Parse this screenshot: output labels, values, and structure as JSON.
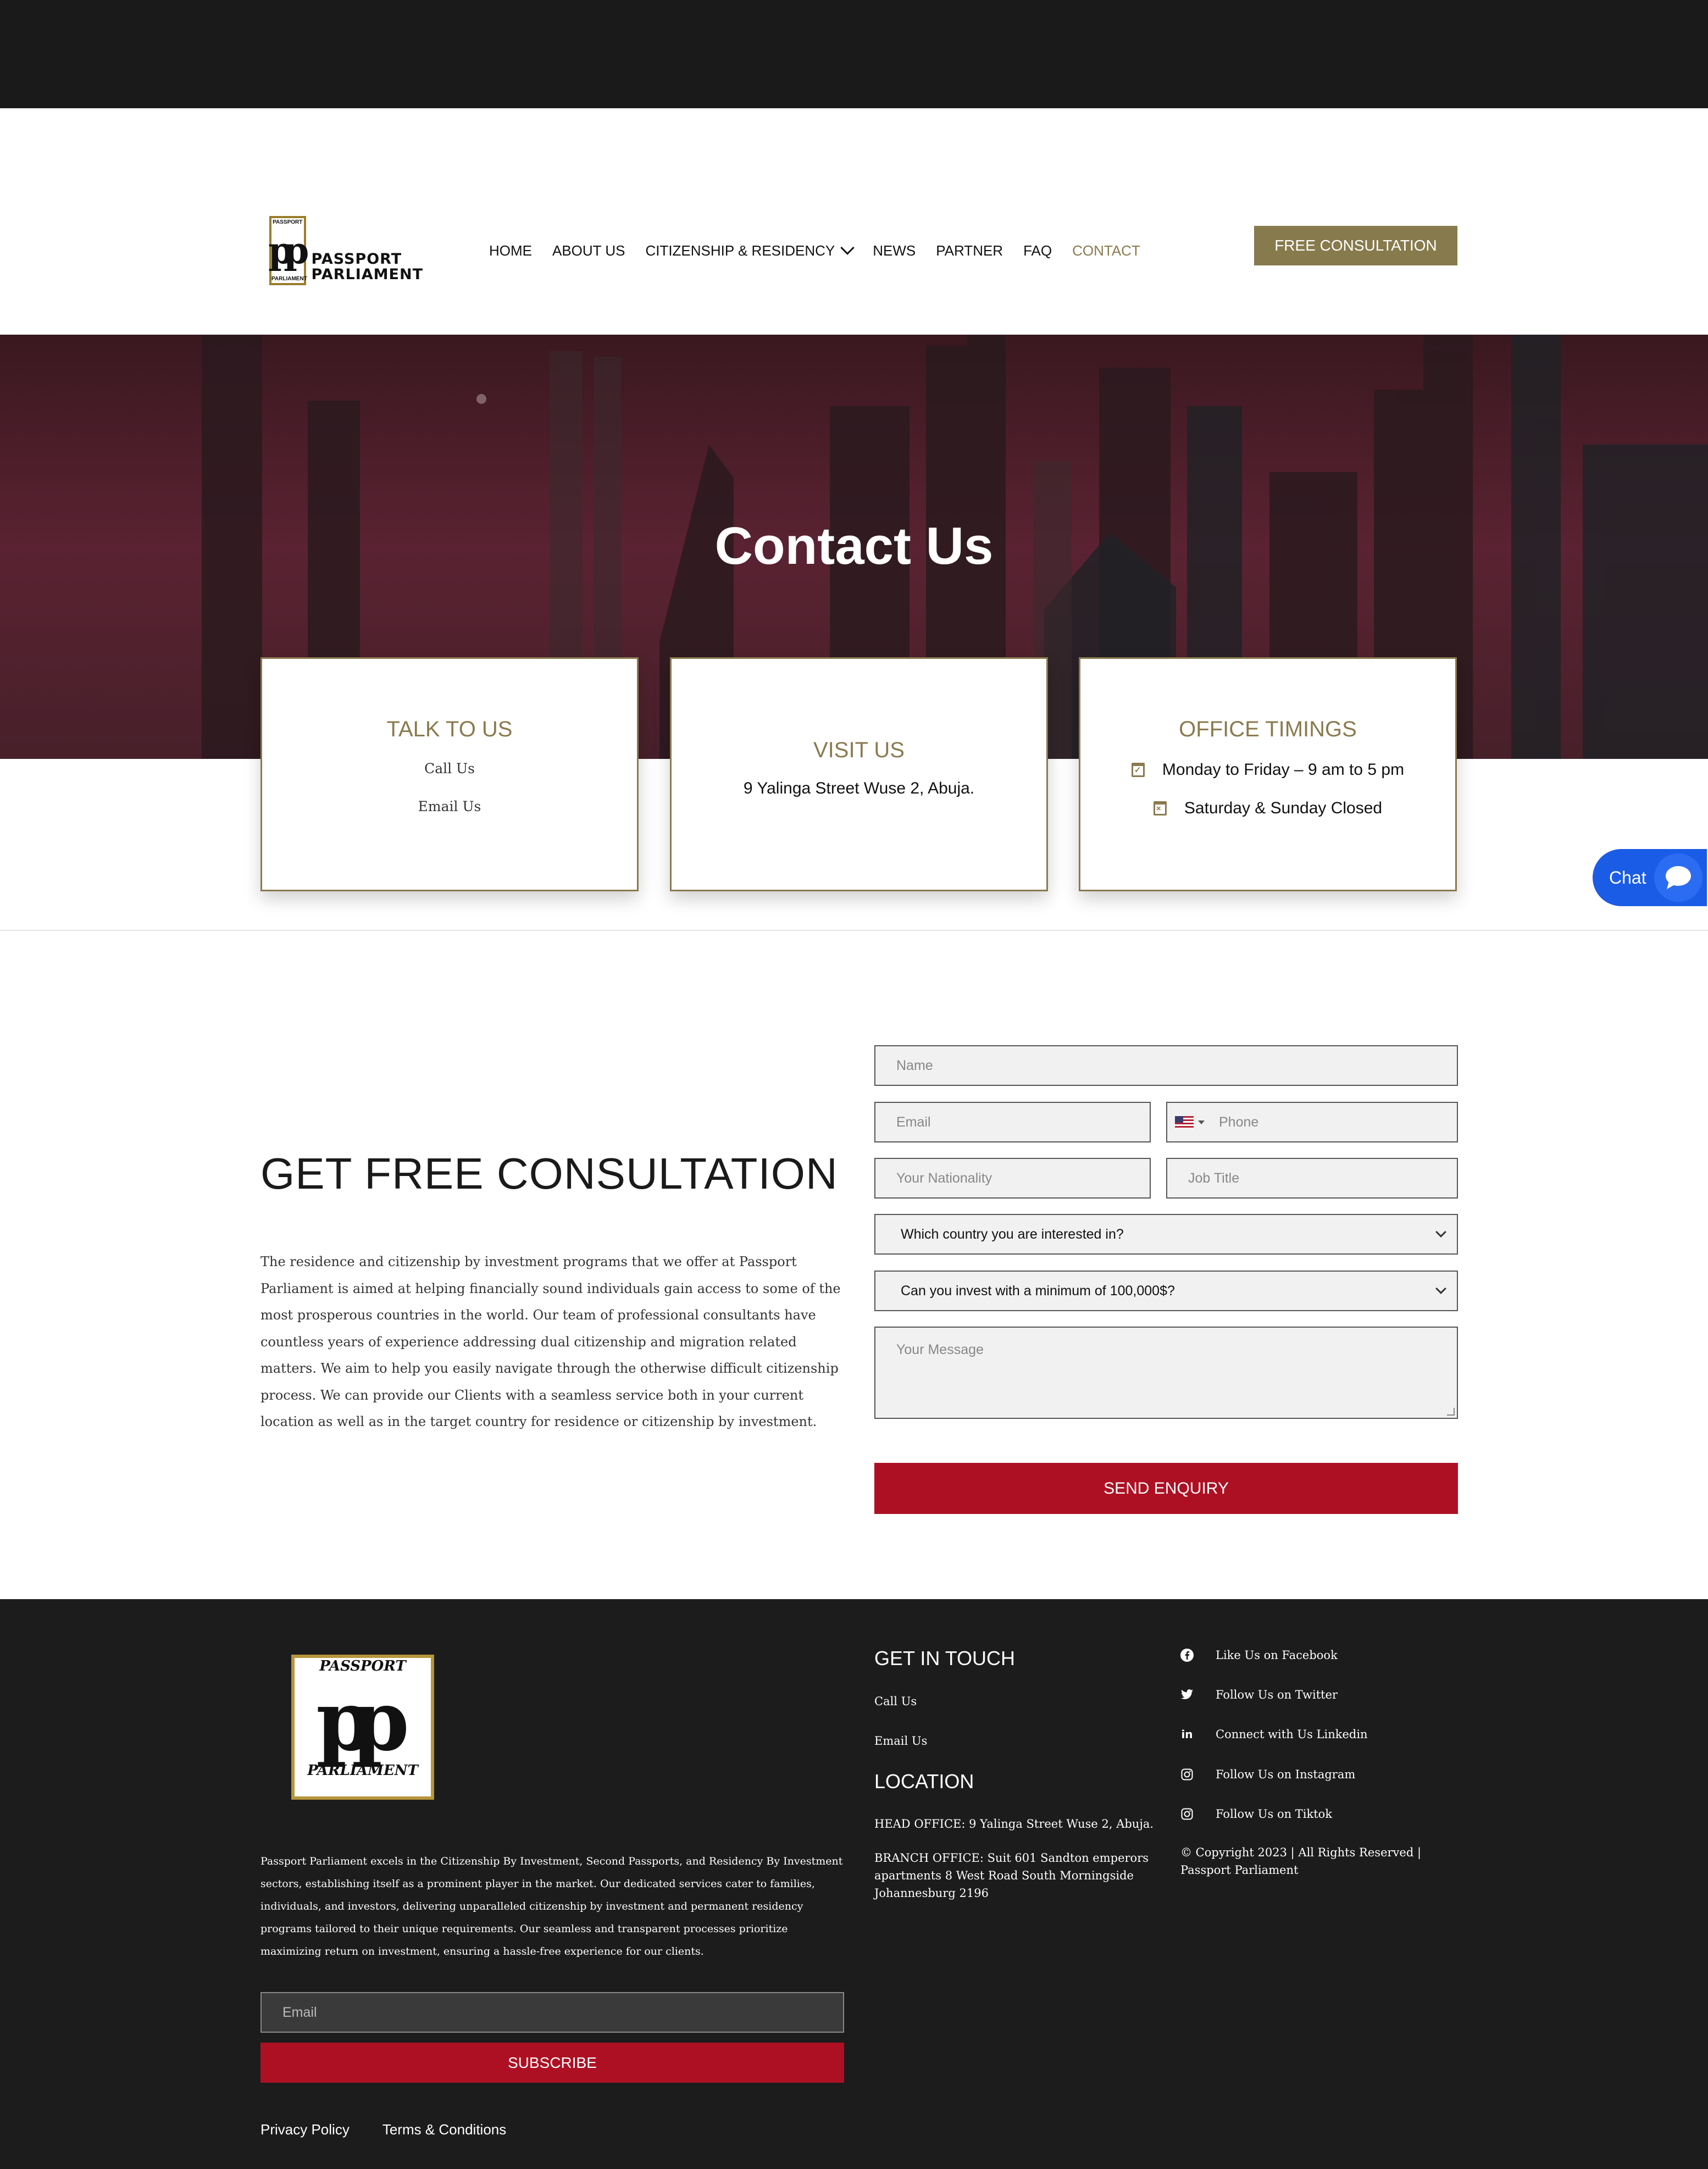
{
  "header": {
    "logo": {
      "top": "PASSPORT",
      "bottom": "PARLIAMENT",
      "text_line1": "PASSPORT",
      "text_line2": "PARLIAMENT"
    },
    "nav": [
      {
        "label": "HOME"
      },
      {
        "label": "ABOUT US"
      },
      {
        "label": "CITIZENSHIP & RESIDENCY"
      },
      {
        "label": "NEWS"
      },
      {
        "label": "PARTNER"
      },
      {
        "label": "FAQ"
      },
      {
        "label": "CONTACT"
      }
    ],
    "cta_label": "FREE CONSULTATION",
    "accent": "#877a4c"
  },
  "hero": {
    "title": "Contact Us"
  },
  "cards": {
    "talk": {
      "title": "TALK TO US",
      "call": "Call Us",
      "email": "Email Us"
    },
    "visit": {
      "title": "VISIT US",
      "address": "9 Yalinga Street Wuse 2, Abuja."
    },
    "timings": {
      "title": "OFFICE TIMINGS",
      "weekdays": "Monday to Friday – 9 am to 5 pm",
      "weekend": "Saturday & Sunday Closed"
    }
  },
  "chat": {
    "label": "Chat"
  },
  "consultation": {
    "title": "GET FREE CONSULTATION",
    "text": "The residence and citizenship by investment programs that we offer at Passport Parliament is aimed at helping financially sound individuals gain access to some of the most prosperous countries in the world. Our team of professional consultants have countless years of experience addressing dual citizenship and migration related matters. We aim to help you easily navigate through the otherwise difficult citizenship process. We can provide our Clients with a seamless service both in your current location as well as in the target country for residence or citizenship by investment."
  },
  "form": {
    "name_placeholder": "Name",
    "email_placeholder": "Email",
    "phone_placeholder": "Phone",
    "nationality_placeholder": "Your Nationality",
    "job_placeholder": "Job Title",
    "country_select": "Which country you are interested in?",
    "invest_select": "Can you invest with a minimum of 100,000$?",
    "message_placeholder": "Your Message",
    "submit_label": "SEND ENQUIRY",
    "submit_color": "#ae1023"
  },
  "footer": {
    "logo_top": "PASSPORT",
    "logo_bottom": "PARLIAMENT",
    "about": "Passport Parliament excels in the Citizenship By Investment, Second Passports, and Residency By Investment sectors, establishing itself as a prominent player in the market. Our dedicated services cater to families, individuals, and investors, delivering unparalleled citizenship by investment and permanent residency programs tailored to their unique requirements. Our seamless and transparent processes prioritize maximizing return on investment, ensuring a hassle-free experience for our clients.",
    "email_placeholder": "Email",
    "subscribe_label": "SUBSCRIBE",
    "privacy": "Privacy Policy",
    "terms": "Terms & Conditions",
    "get_in_touch": "GET IN TOUCH",
    "call": "Call Us",
    "email_us": "Email Us",
    "location_title": "LOCATION",
    "head_office": "HEAD OFFICE: 9 Yalinga Street Wuse 2, Abuja.",
    "branch_office": "BRANCH OFFICE: Suit 601 Sandton emperors apartments 8 West Road South Morningside Johannesburg 2196",
    "social": [
      {
        "icon": "facebook-icon",
        "label": "Like Us on Facebook"
      },
      {
        "icon": "twitter-icon",
        "label": "Follow Us on Twitter"
      },
      {
        "icon": "linkedin-icon",
        "label": "Connect with Us Linkedin"
      },
      {
        "icon": "instagram-icon",
        "label": "Follow Us on Instagram"
      },
      {
        "icon": "tiktok-icon",
        "label": "Follow Us on Tiktok"
      }
    ],
    "copyright": "© Copyright 2023 | All Rights Reserved | Passport Parliament"
  }
}
